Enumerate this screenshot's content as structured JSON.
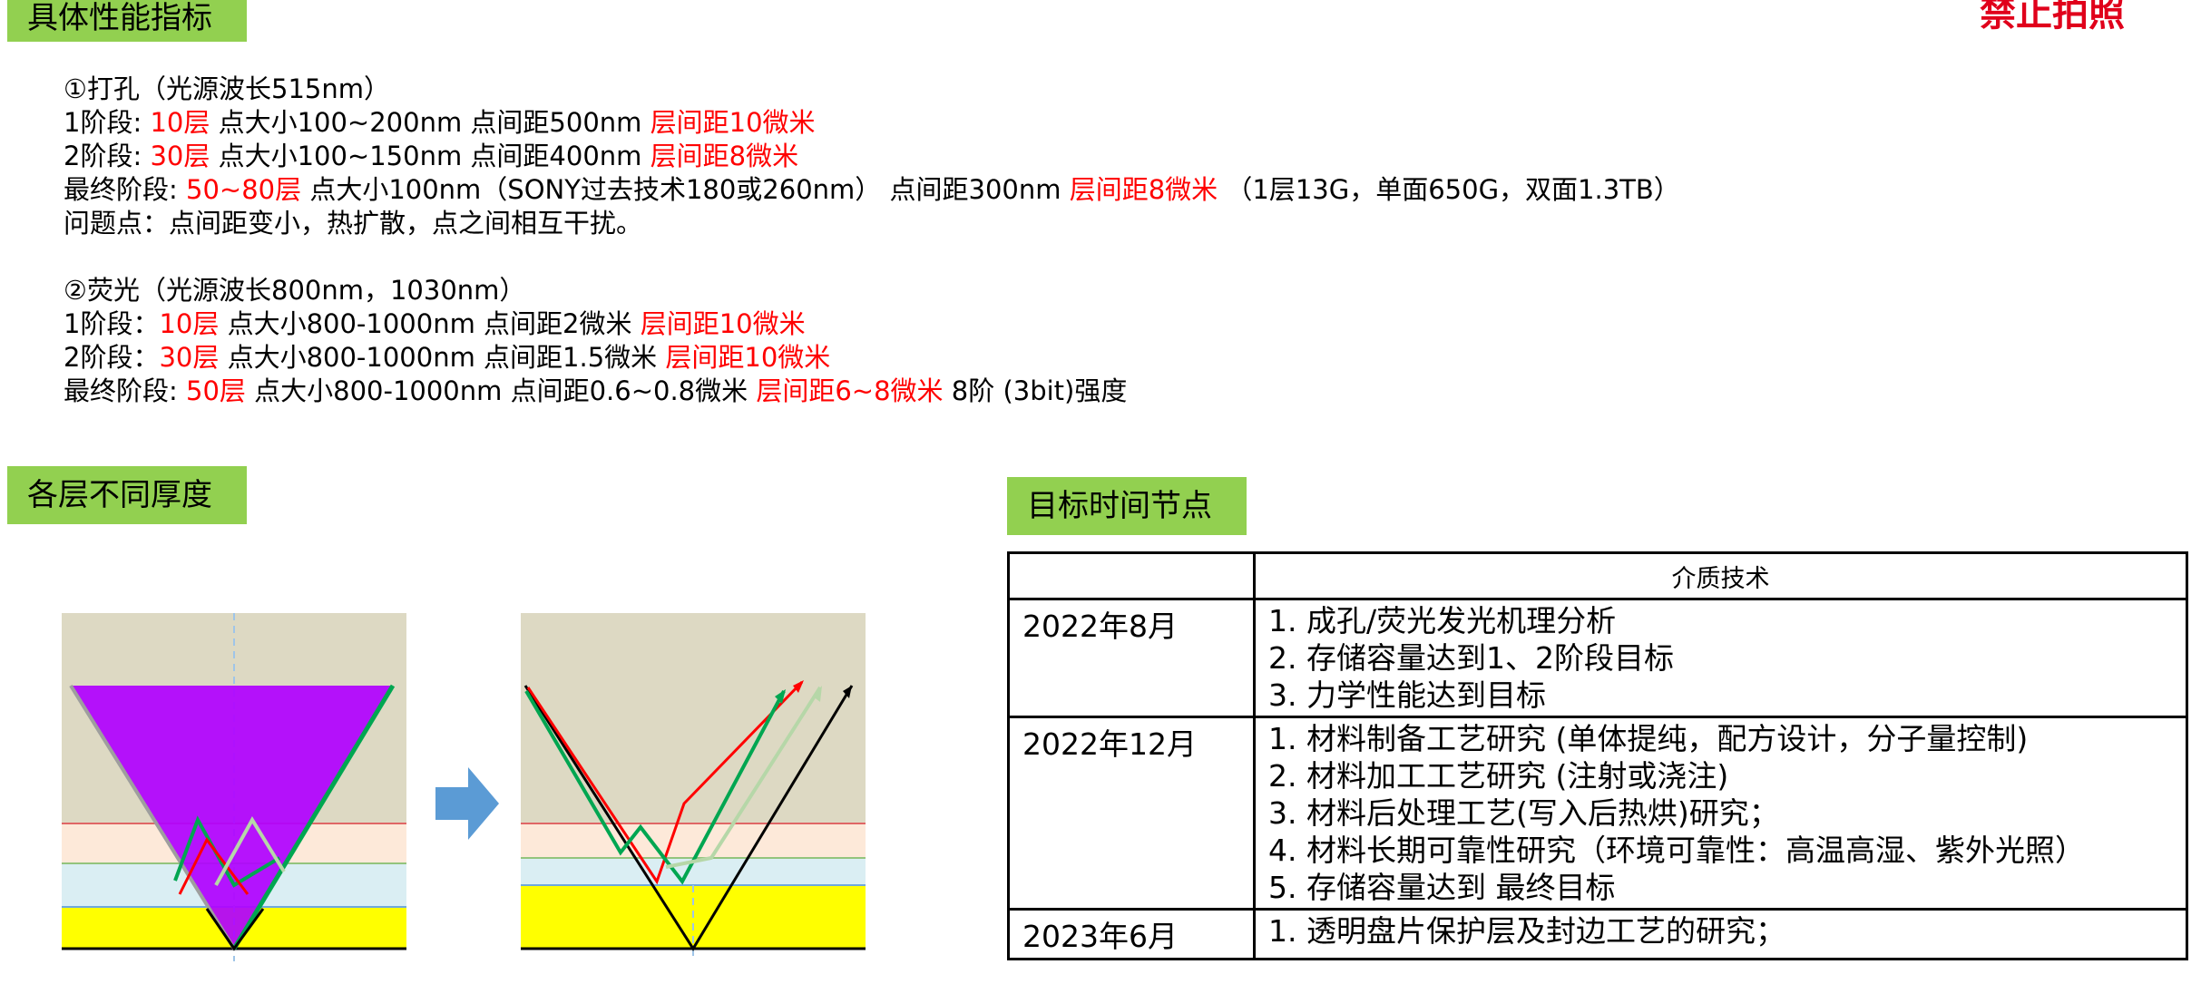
{
  "stamp": "禁止拍照",
  "sections": {
    "specs": "具体性能指标",
    "layers": "各层不同厚度",
    "schedule": "目标时间节点"
  },
  "drilling": {
    "title": "①打孔（光源波长515nm）",
    "stage1": {
      "label": "1阶段: ",
      "layers": "10层",
      "mid": " 点大小100~200nm  点间距500nm  ",
      "pitch": "层间距10微米"
    },
    "stage2": {
      "label": "2阶段: ",
      "layers": "30层",
      "mid": " 点大小100~150nm  点间距400nm  ",
      "pitch": "层间距8微米"
    },
    "final": {
      "label": "最终阶段: ",
      "layers": "50~80层",
      "mid": " 点大小100nm（SONY过去技术180或260nm）  点间距300nm  ",
      "pitch": "层间距8微米",
      "tail": "   （1层13G，单面650G，双面1.3TB）"
    },
    "issue": "问题点：点间距变小，热扩散，点之间相互干扰。"
  },
  "fluorescence": {
    "title": "②荧光（光源波长800nm，1030nm）",
    "stage1": {
      "label": "1阶段：",
      "layers": "10层",
      "mid": " 点大小800-1000nm  点间距2微米  ",
      "pitch": "层间距10微米"
    },
    "stage2": {
      "label": "2阶段：",
      "layers": "30层",
      "mid": " 点大小800-1000nm  点间距1.5微米  ",
      "pitch": "层间距10微米"
    },
    "final": {
      "label": "最终阶段: ",
      "layers": "50层",
      "mid": " 点大小800-1000nm  点间距0.6~0.8微米  ",
      "pitch": "层间距6~8微米",
      "tail": " 8阶 (3bit)强度"
    }
  },
  "schedule": {
    "header": {
      "date": "",
      "tech": "介质技术"
    },
    "rows": [
      {
        "date": "2022年8月",
        "items": [
          "1. 成孔/荧光发光机理分析",
          "2. 存储容量达到1、2阶段目标",
          "3. 力学性能达到目标"
        ]
      },
      {
        "date": "2022年12月",
        "items": [
          "1. 材料制备工艺研究 (单体提纯，配方设计，分子量控制)",
          "2. 材料加工工艺研究 (注射或浇注)",
          "3. 材料后处理工艺(写入后热烘)研究；",
          "4. 材料长期可靠性研究（环境可靠性：高温高湿、紫外光照）",
          "5. 存储容量达到 最终目标"
        ]
      },
      {
        "date": "2023年6月",
        "items": [
          "1. 透明盘片保护层及封边工艺的研究；"
        ]
      }
    ]
  },
  "colors": {
    "tag_green": "#92d050",
    "highlight_red": "#ff0000",
    "cone_purple": "#b000ff",
    "layer_yellow": "#ffff00",
    "layer_blue": "#daeef3",
    "layer_peach": "#fde9d9",
    "background_beige": "#ddd9c3",
    "arrow_blue": "#5b9bd5"
  },
  "icons": {
    "transition_arrow": "right-arrow-icon"
  }
}
